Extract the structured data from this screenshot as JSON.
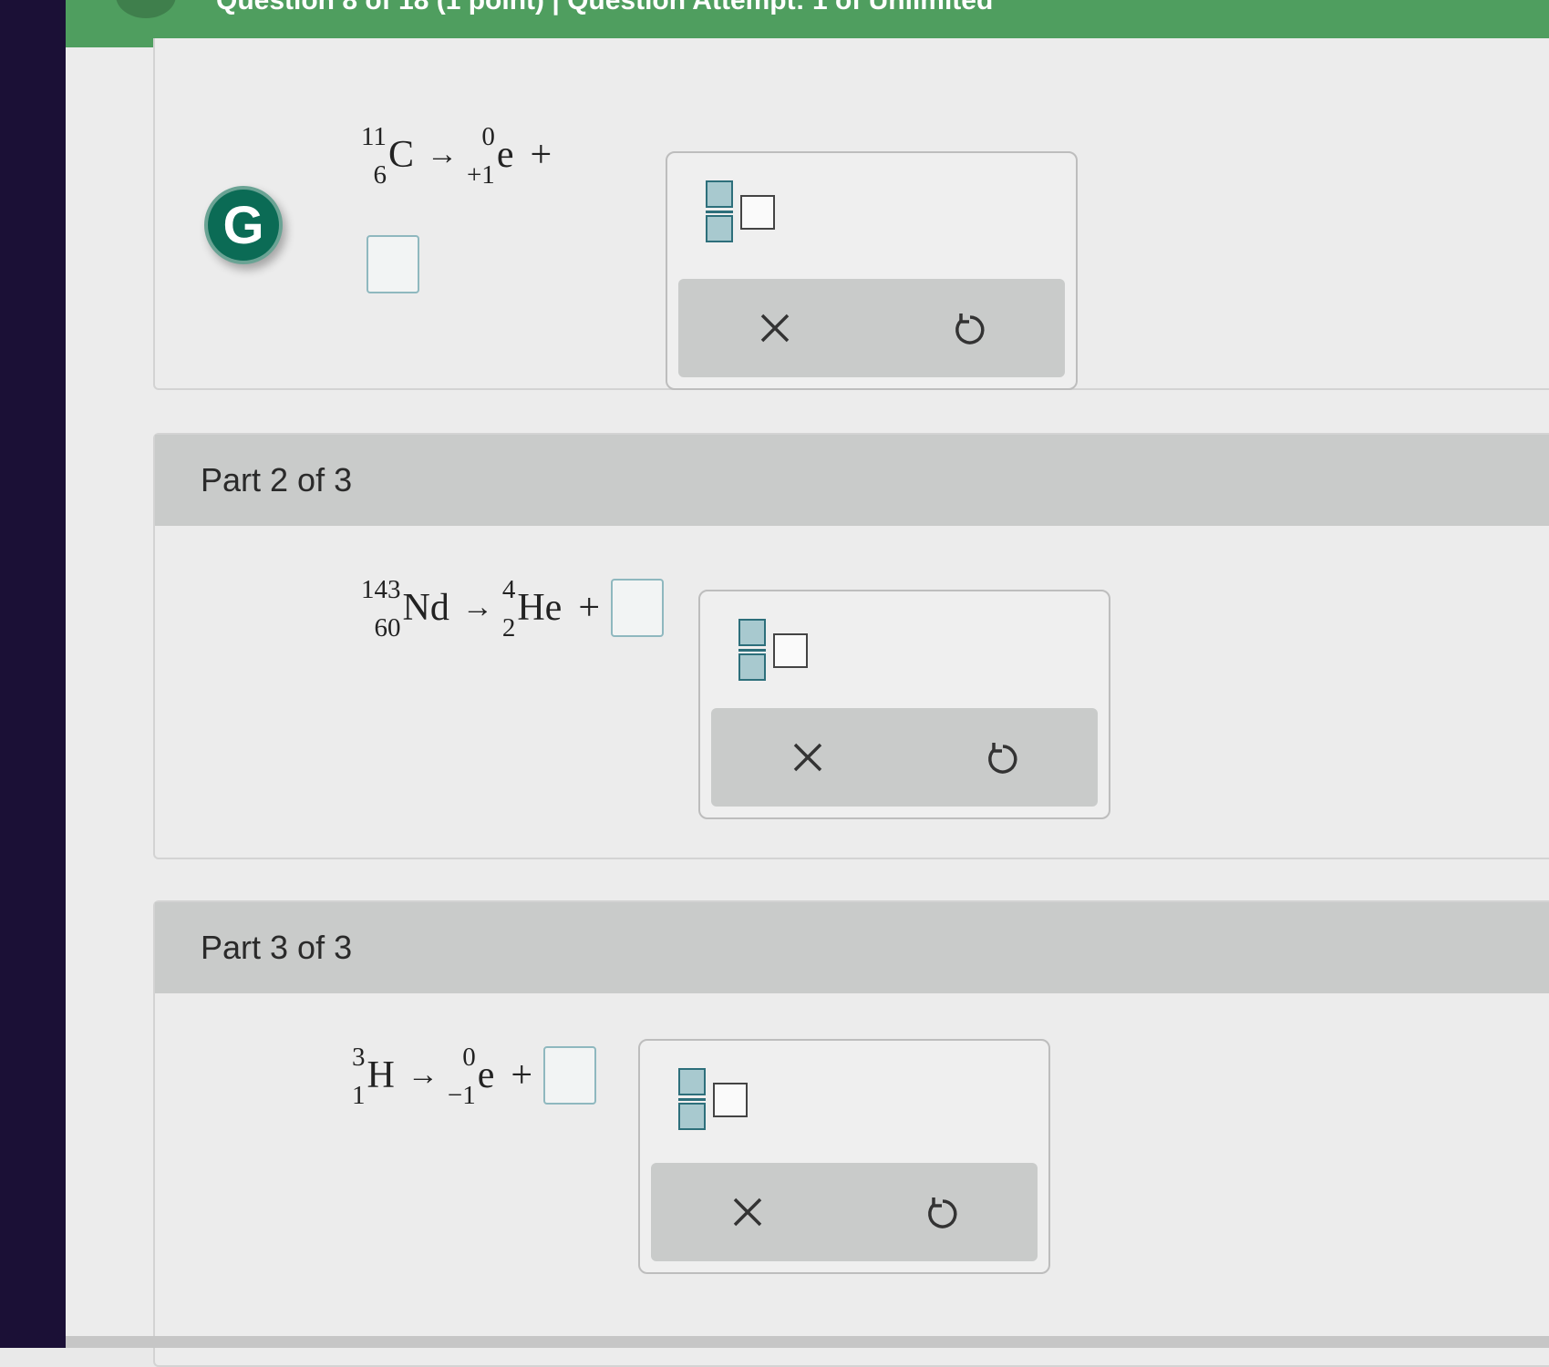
{
  "header": {
    "question_info": "Question 8 of 18 (1 point) | Question Attempt: 1 of Unlimited"
  },
  "badge": {
    "letter": "G"
  },
  "parts": [
    {
      "label": "",
      "equation": {
        "reactant": {
          "mass": "11",
          "atomic": "6",
          "symbol": "C"
        },
        "arrow": "→",
        "product": {
          "mass": "0",
          "atomic": "+1",
          "symbol": "e"
        },
        "plus": "+"
      }
    },
    {
      "label": "Part 2 of 3",
      "equation": {
        "reactant": {
          "mass": "143",
          "atomic": "60",
          "symbol": "Nd"
        },
        "arrow": "→",
        "product": {
          "mass": "4",
          "atomic": "2",
          "symbol": "He"
        },
        "plus": "+"
      }
    },
    {
      "label": "Part 3 of 3",
      "equation": {
        "reactant": {
          "mass": "3",
          "atomic": "1",
          "symbol": "H"
        },
        "arrow": "→",
        "product": {
          "mass": "0",
          "atomic": "−1",
          "symbol": "e"
        },
        "plus": "+"
      }
    }
  ],
  "palette": {
    "fraction_icon": "fraction-template-icon",
    "clear_icon": "close-icon",
    "undo_icon": "undo-icon",
    "accent": "#2d6f7b"
  },
  "colors": {
    "topbar": "#4f9e5f",
    "badge": "#0b6b55",
    "header_bg": "#c9cbca"
  }
}
